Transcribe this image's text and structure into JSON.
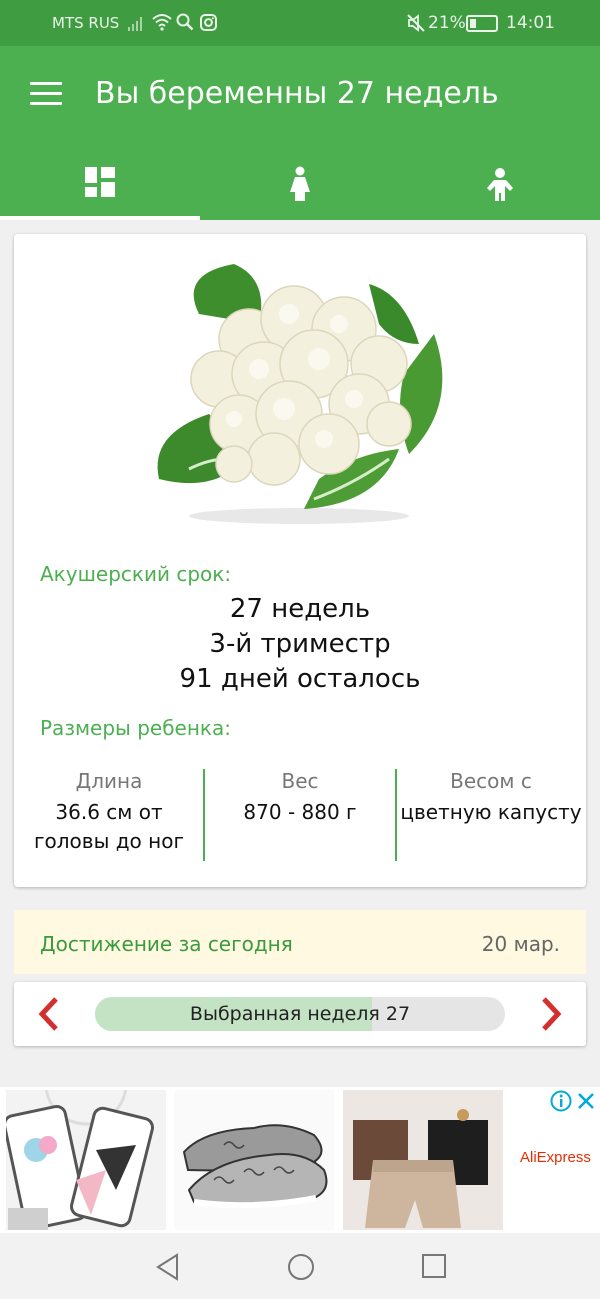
{
  "status_bar": {
    "carrier": "MTS RUS",
    "battery": "21%",
    "time": "14:01"
  },
  "app_bar": {
    "title": "Вы беременны 27 недель"
  },
  "tabs": [
    {
      "icon": "dashboard-icon",
      "active": true
    },
    {
      "icon": "woman-icon",
      "active": false
    },
    {
      "icon": "child-icon",
      "active": false
    }
  ],
  "card": {
    "term_label": "Акушерский срок:",
    "weeks": "27 недель",
    "trimester": "3-й триместр",
    "days_left": "91 дней осталось",
    "size_label": "Размеры ребенка:",
    "length_header": "Длина",
    "length_value_1": "36.6 см от",
    "length_value_2": "головы до ног",
    "weight_header": "Вес",
    "weight_value": "870 - 880 г",
    "compare_header": "Весом с",
    "compare_value": "цветную капусту"
  },
  "achievement": {
    "title": "Достижение за сегодня",
    "date": "20 мар."
  },
  "week_selector": {
    "label": "Выбранная неделя 27",
    "progress_fraction": 0.675
  },
  "ad": {
    "brand": "AliExpress"
  },
  "colors": {
    "primary": "#4caf50",
    "status_bar": "#3f9c41",
    "arrow": "#d32f2f",
    "achievement_bg": "#fff9e1"
  }
}
